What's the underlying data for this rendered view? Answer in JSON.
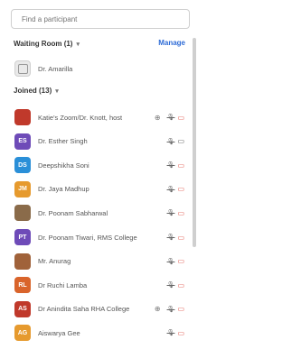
{
  "search": {
    "placeholder": "Find a participant"
  },
  "waiting_room": {
    "title": "Waiting Room (1)",
    "manage_label": "Manage",
    "participant": "Dr. Amarilla"
  },
  "joined": {
    "title": "Joined (13)",
    "participants": [
      {
        "name": "Katie's Zoom/Dr. Knott, host",
        "initials": "",
        "color": "#c0392b",
        "cam": "off",
        "extra": "⊕"
      },
      {
        "name": "Dr. Esther Singh",
        "initials": "ES",
        "color": "#6e4bb8",
        "cam": "on",
        "extra": ""
      },
      {
        "name": "Deepshikha Soni",
        "initials": "DS",
        "color": "#2a8fd8",
        "cam": "off",
        "extra": ""
      },
      {
        "name": "Dr. Jaya Madhup",
        "initials": "JM",
        "color": "#e69a2e",
        "cam": "off",
        "extra": ""
      },
      {
        "name": "Dr. Poonam Sabharwal",
        "initials": "",
        "color": "#8a6b4a",
        "cam": "off",
        "extra": ""
      },
      {
        "name": "Dr. Poonam Tiwari, RMS College",
        "initials": "PT",
        "color": "#6e4bb8",
        "cam": "off",
        "extra": ""
      },
      {
        "name": "Mr. Anurag",
        "initials": "",
        "color": "#a0623a",
        "cam": "off",
        "extra": ""
      },
      {
        "name": "Dr Ruchi Lamba",
        "initials": "RL",
        "color": "#d9642b",
        "cam": "off",
        "extra": ""
      },
      {
        "name": "Dr Anindita Saha RHA College",
        "initials": "AS",
        "color": "#c0392b",
        "cam": "off",
        "extra": "⊕"
      },
      {
        "name": "Aiswarya Gee",
        "initials": "AG",
        "color": "#e69a2e",
        "cam": "off",
        "extra": ""
      }
    ]
  },
  "icons": {
    "mic": "mic-muted-icon",
    "camera": "camera-icon"
  }
}
